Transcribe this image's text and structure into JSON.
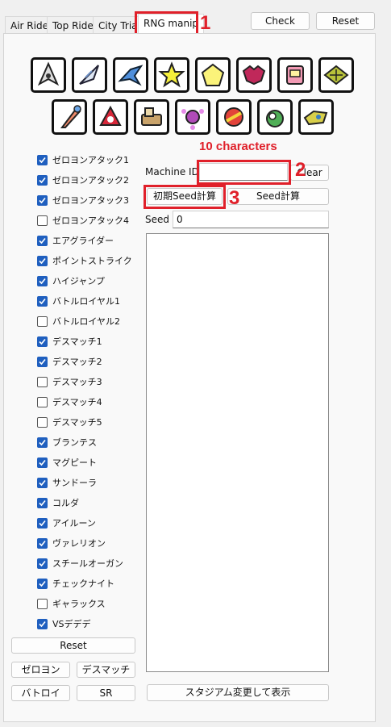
{
  "tabs": [
    {
      "label": "Air Ride",
      "active": false
    },
    {
      "label": "Top Ride",
      "active": false
    },
    {
      "label": "City Trial",
      "active": false
    },
    {
      "label": "RNG manip",
      "active": true
    }
  ],
  "top_buttons": {
    "check": "Check",
    "reset": "Reset"
  },
  "icons_row1": [
    "warpstar-icon",
    "wingstar-icon",
    "jetstar-icon",
    "compactstar-icon",
    "slickstar-icon",
    "wheelie-bike-icon",
    "rex-wheelie-icon",
    "formula-star-icon"
  ],
  "icons_row2": [
    "rocketstar-icon",
    "shadowstar-icon",
    "turbostar-icon",
    "winged-star-icon",
    "swerve-star-icon",
    "bulk-star-icon",
    "hydra-icon"
  ],
  "annotations": {
    "n1": "1",
    "n2": "2",
    "n3": "3",
    "chars_note": "10 characters"
  },
  "checklist": [
    {
      "label": "ゼロヨンアタック1",
      "checked": true
    },
    {
      "label": "ゼロヨンアタック2",
      "checked": true
    },
    {
      "label": "ゼロヨンアタック3",
      "checked": true
    },
    {
      "label": "ゼロヨンアタック4",
      "checked": false
    },
    {
      "label": "エアグライダー",
      "checked": true
    },
    {
      "label": "ポイントストライク",
      "checked": true
    },
    {
      "label": "ハイジャンプ",
      "checked": true
    },
    {
      "label": "バトルロイヤル1",
      "checked": true
    },
    {
      "label": "バトルロイヤル2",
      "checked": false
    },
    {
      "label": "デスマッチ1",
      "checked": true
    },
    {
      "label": "デスマッチ2",
      "checked": true
    },
    {
      "label": "デスマッチ3",
      "checked": false
    },
    {
      "label": "デスマッチ4",
      "checked": false
    },
    {
      "label": "デスマッチ5",
      "checked": false
    },
    {
      "label": "ブランテス",
      "checked": true
    },
    {
      "label": "マグピート",
      "checked": true
    },
    {
      "label": "サンドーラ",
      "checked": true
    },
    {
      "label": "コルダ",
      "checked": true
    },
    {
      "label": "アイルーン",
      "checked": true
    },
    {
      "label": "ヴァレリオン",
      "checked": true
    },
    {
      "label": "スチールオーガン",
      "checked": true
    },
    {
      "label": "チェックナイト",
      "checked": true
    },
    {
      "label": "ギャラックス",
      "checked": false
    },
    {
      "label": "VSデデデ",
      "checked": true
    }
  ],
  "left_buttons": {
    "reset": "Reset",
    "zeroyon": "ゼロヨン",
    "deathmatch": "デスマッチ",
    "battle": "バトロイ",
    "sr": "SR"
  },
  "machine_id": {
    "label": "Machine ID",
    "value": "",
    "clear": "Clear"
  },
  "seed_buttons": {
    "initial": "初期Seed計算",
    "seed": "Seed計算"
  },
  "seed": {
    "label": "Seed",
    "value": "0"
  },
  "output_text": "",
  "stadium_button": "スタジアム変更して表示"
}
